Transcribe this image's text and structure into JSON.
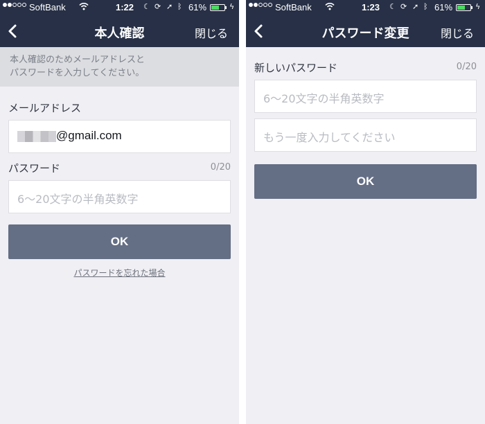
{
  "status_bar": {
    "left": {
      "carrier": "SoftBank",
      "time": "1:22",
      "battery_percent": "61%",
      "battery_level": 0.61,
      "signal_bars": 2
    },
    "right": {
      "carrier": "SoftBank",
      "time": "1:23",
      "battery_percent": "61%",
      "battery_level": 0.61,
      "signal_bars": 2
    },
    "icons": [
      "wifi-icon",
      "moon-icon",
      "rotation-lock-icon",
      "location-arrow-icon",
      "bluetooth-icon",
      "battery-icon",
      "charging-bolt-icon"
    ]
  },
  "colors": {
    "nav_background": "#273046",
    "screen_background": "#efeff4",
    "banner_background": "#dcdde1",
    "button_background": "#646e85",
    "battery_fill": "#4cd964"
  },
  "left_screen": {
    "nav": {
      "back_icon": "chevron-left-icon",
      "title": "本人確認",
      "close_label": "閉じる"
    },
    "info_banner": {
      "line1": "本人確認のためメールアドレスと",
      "line2": "パスワードを入力してください。"
    },
    "email": {
      "label": "メールアドレス",
      "value": "@gmail.com"
    },
    "password": {
      "label": "パスワード",
      "counter": "0/20",
      "placeholder": "6〜20文字の半角英数字"
    },
    "ok_label": "OK",
    "forgot_link": "パスワードを忘れた場合"
  },
  "right_screen": {
    "nav": {
      "back_icon": "chevron-left-icon",
      "title": "パスワード変更",
      "close_label": "閉じる"
    },
    "new_password": {
      "label": "新しいパスワード",
      "counter": "0/20",
      "placeholder": "6〜20文字の半角英数字",
      "confirm_placeholder": "もう一度入力してください"
    },
    "ok_label": "OK"
  }
}
